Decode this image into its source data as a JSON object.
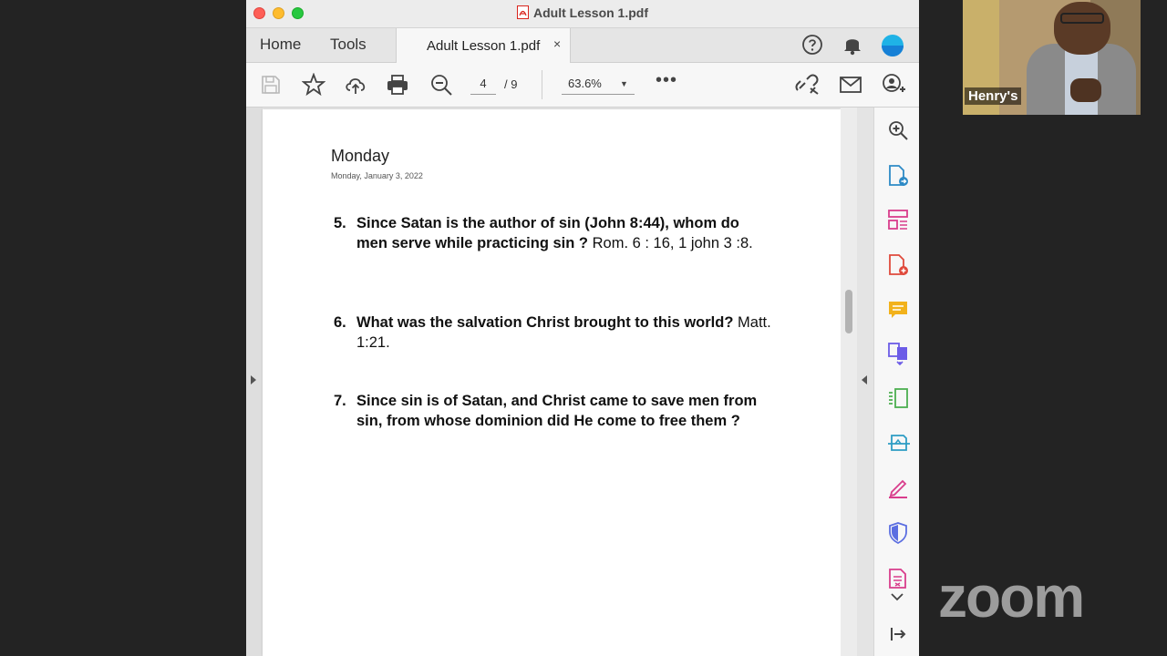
{
  "window": {
    "title": "Adult Lesson 1.pdf"
  },
  "tabs": {
    "home": "Home",
    "tools": "Tools",
    "document": "Adult Lesson 1.pdf",
    "close": "×"
  },
  "toolbar": {
    "page_current": "4",
    "page_total": "/ 9",
    "zoom": "63.6%",
    "more": "•••"
  },
  "document": {
    "day": "Monday",
    "date": "Monday, January 3, 2022",
    "questions": [
      {
        "num": "5.",
        "bold": "Since Satan is the author of sin (John 8:44), whom do men serve while practicing sin ?",
        "ref": "Rom. 6 : 16, 1 john 3 :8."
      },
      {
        "num": "6.",
        "bold": "What was the salvation Christ brought to this world?",
        "ref": "Matt. 1:21."
      },
      {
        "num": "7.",
        "bold": "Since sin is of Satan, and Christ came to save men from sin, from whose dominion did He come to free them ?",
        "ref": ""
      }
    ]
  },
  "participant": {
    "name": "Henry's"
  },
  "brand": {
    "zoom_logo": "zoom"
  },
  "colors": {
    "accent": "#1473e6",
    "close": "#fe5f57",
    "minimize": "#febc2e",
    "maximize": "#28c840"
  },
  "icons": {
    "toolbar": [
      "save-icon",
      "star-icon",
      "upload-icon",
      "print-icon",
      "zoom-out-icon",
      "link-icon",
      "mail-icon",
      "add-user-icon"
    ],
    "tabbar": [
      "help-icon",
      "bell-icon",
      "avatar"
    ],
    "right_panel": [
      "zoom-in-icon",
      "export-pdf-icon",
      "organize-pages-icon",
      "create-pdf-icon",
      "comment-icon",
      "combine-files-icon",
      "edit-pdf-icon",
      "scan-icon",
      "fill-sign-icon",
      "protect-icon",
      "compress-icon",
      "chevron-down-icon",
      "collapse-panel-icon"
    ]
  }
}
